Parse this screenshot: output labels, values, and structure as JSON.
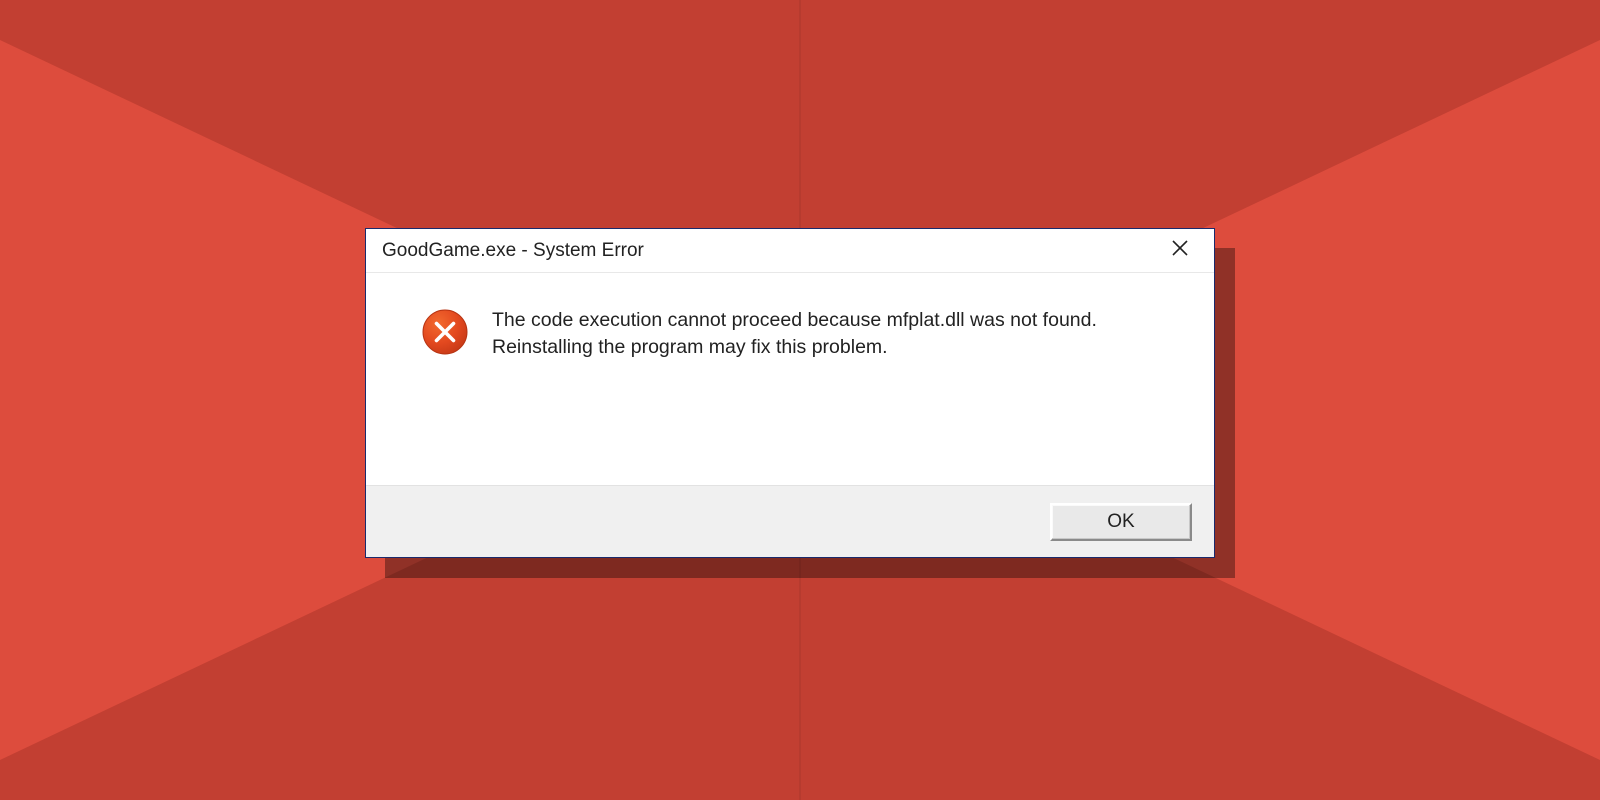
{
  "background": {
    "base_color": "#c23f32",
    "accent_color": "#dd4c3d"
  },
  "dialog": {
    "title": "GoodGame.exe - System Error",
    "icon": "error-x-icon",
    "message": "The code execution cannot proceed because mfplat.dll was not found. Reinstalling the program may fix this problem.",
    "ok_label": "OK",
    "close_icon": "close-icon"
  }
}
